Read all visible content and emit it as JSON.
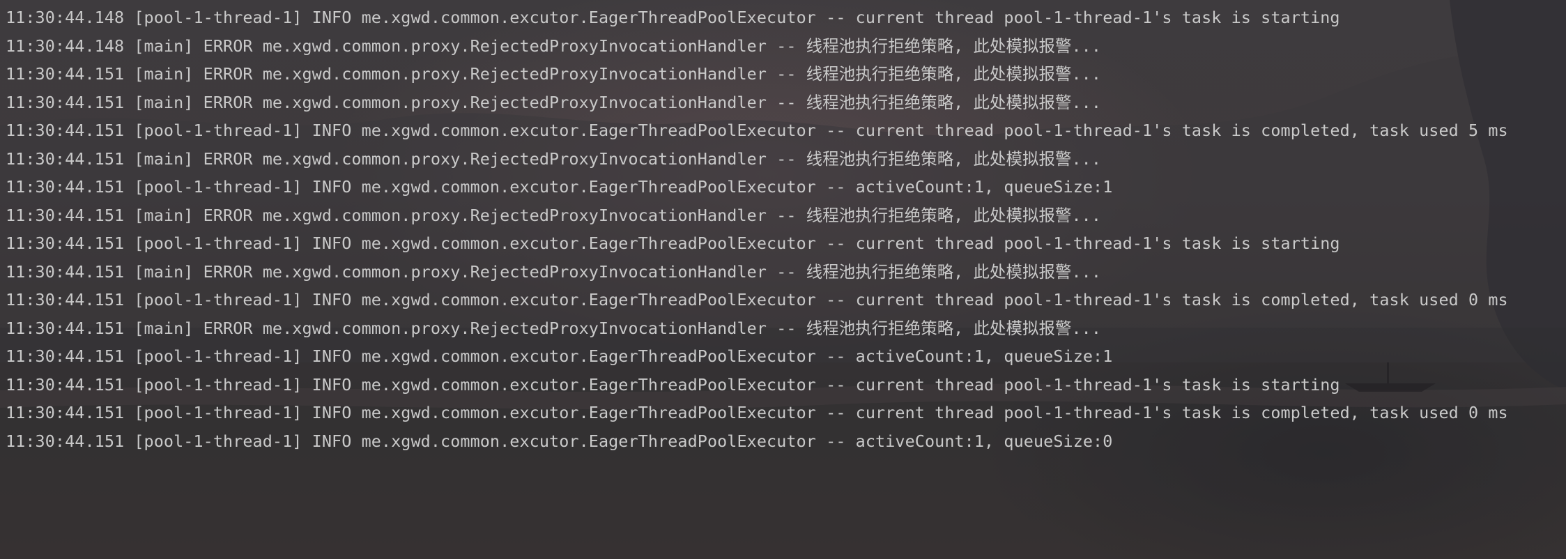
{
  "console": {
    "lines": [
      "11:30:44.148 [pool-1-thread-1] INFO me.xgwd.common.excutor.EagerThreadPoolExecutor -- current thread pool-1-thread-1's task is starting",
      "11:30:44.148 [main] ERROR me.xgwd.common.proxy.RejectedProxyInvocationHandler -- 线程池执行拒绝策略, 此处模拟报警...",
      "11:30:44.151 [main] ERROR me.xgwd.common.proxy.RejectedProxyInvocationHandler -- 线程池执行拒绝策略, 此处模拟报警...",
      "11:30:44.151 [main] ERROR me.xgwd.common.proxy.RejectedProxyInvocationHandler -- 线程池执行拒绝策略, 此处模拟报警...",
      "11:30:44.151 [pool-1-thread-1] INFO me.xgwd.common.excutor.EagerThreadPoolExecutor -- current thread pool-1-thread-1's task is completed, task used 5 ms",
      "11:30:44.151 [main] ERROR me.xgwd.common.proxy.RejectedProxyInvocationHandler -- 线程池执行拒绝策略, 此处模拟报警...",
      "11:30:44.151 [pool-1-thread-1] INFO me.xgwd.common.excutor.EagerThreadPoolExecutor -- activeCount:1, queueSize:1",
      "11:30:44.151 [main] ERROR me.xgwd.common.proxy.RejectedProxyInvocationHandler -- 线程池执行拒绝策略, 此处模拟报警...",
      "11:30:44.151 [pool-1-thread-1] INFO me.xgwd.common.excutor.EagerThreadPoolExecutor -- current thread pool-1-thread-1's task is starting",
      "11:30:44.151 [main] ERROR me.xgwd.common.proxy.RejectedProxyInvocationHandler -- 线程池执行拒绝策略, 此处模拟报警...",
      "11:30:44.151 [pool-1-thread-1] INFO me.xgwd.common.excutor.EagerThreadPoolExecutor -- current thread pool-1-thread-1's task is completed, task used 0 ms",
      "11:30:44.151 [main] ERROR me.xgwd.common.proxy.RejectedProxyInvocationHandler -- 线程池执行拒绝策略, 此处模拟报警...",
      "11:30:44.151 [pool-1-thread-1] INFO me.xgwd.common.excutor.EagerThreadPoolExecutor -- activeCount:1, queueSize:1",
      "11:30:44.151 [pool-1-thread-1] INFO me.xgwd.common.excutor.EagerThreadPoolExecutor -- current thread pool-1-thread-1's task is starting",
      "11:30:44.151 [pool-1-thread-1] INFO me.xgwd.common.excutor.EagerThreadPoolExecutor -- current thread pool-1-thread-1's task is completed, task used 0 ms",
      "11:30:44.151 [pool-1-thread-1] INFO me.xgwd.common.excutor.EagerThreadPoolExecutor -- activeCount:1, queueSize:0"
    ]
  },
  "colors": {
    "text": "#c9c9c9",
    "background": "#3a3838"
  }
}
